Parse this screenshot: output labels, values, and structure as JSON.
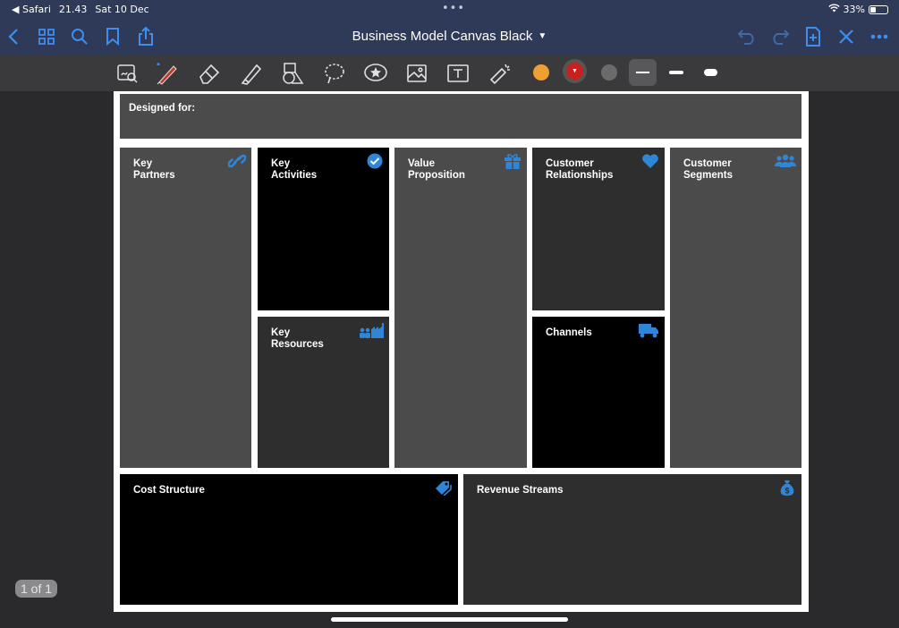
{
  "status": {
    "back_app": "◀ Safari",
    "time": "21.43",
    "date": "Sat 10 Dec",
    "battery": "33%"
  },
  "nav": {
    "title": "Business Model Canvas Black"
  },
  "canvas": {
    "designed_for": "Designed for:",
    "key_partners": "Key\nPartners",
    "key_activities": "Key\nActivities",
    "value_proposition": "Value\nProposition",
    "customer_relationships": "Customer\nRelationships",
    "customer_segments": "Customer\nSegments",
    "key_resources": "Key\nResources",
    "channels": "Channels",
    "cost_structure": "Cost Structure",
    "revenue_streams": "Revenue Streams"
  },
  "pager": "1 of 1",
  "colors": {
    "accent": "#3d8ef0",
    "icon_blue": "#2f86d8",
    "swatch_orange": "#f0a030",
    "swatch_red": "#c8201e",
    "swatch_gray": "#6b6b6b"
  }
}
